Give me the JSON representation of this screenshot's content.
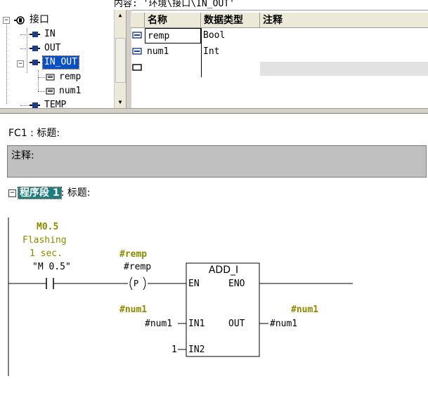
{
  "interface_pane": {
    "breadcrumb": "内容: '环境\\接口\\IN_OUT'",
    "tree": {
      "root": "接口",
      "items": [
        {
          "label": "IN"
        },
        {
          "label": "OUT"
        },
        {
          "label": "IN_OUT",
          "selected": true
        },
        {
          "label": "remp"
        },
        {
          "label": "num1"
        },
        {
          "label": "TEMP"
        }
      ]
    },
    "table": {
      "headers": [
        "名称",
        "数据类型",
        "注释"
      ],
      "rows": [
        {
          "name": "remp",
          "type": "Bool",
          "comment": ""
        },
        {
          "name": "num1",
          "type": "Int",
          "comment": ""
        },
        {
          "name": "",
          "type": "",
          "comment": ""
        }
      ]
    }
  },
  "block": {
    "title": "FC1 : 标题:",
    "comment": "注释:"
  },
  "network": {
    "segment_label": "程序段  1",
    "title": ": 标题:",
    "contact": {
      "address": "M0.5",
      "comment_line1": "Flashing",
      "comment_line2": "1 sec.",
      "symbol": "\"M 0.5\""
    },
    "edge": {
      "symbol_bold": "#remp",
      "symbol": "#remp",
      "label": "P"
    },
    "box": {
      "title": "ADD_I",
      "en": "EN",
      "eno": "ENO",
      "in1": "IN1",
      "in2": "IN2",
      "out": "OUT",
      "in1_symbol_bold": "#num1",
      "in1_symbol": "#num1",
      "in2_value": "1",
      "out_symbol_bold": "#num1",
      "out_symbol": "#num1"
    }
  },
  "colors": {
    "selection": "#0a4fc4",
    "segment_highlight": "#1e7d7d",
    "operand_olive": "#8b8b00",
    "comment_background": "#c0c0c0"
  }
}
